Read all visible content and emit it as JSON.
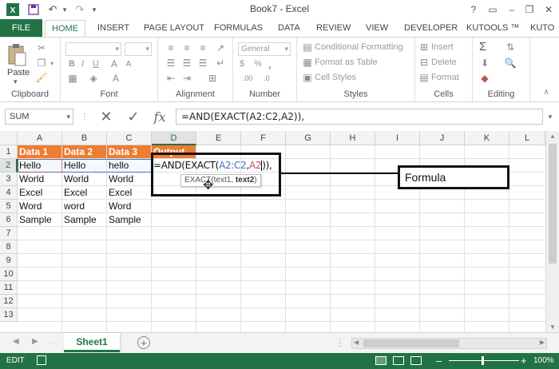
{
  "app": {
    "window_title": "Book7 - Excel",
    "quick_access": [
      "excel-logo-icon",
      "save-icon",
      "undo-icon",
      "redo-icon",
      "customize-icon"
    ],
    "window_controls": [
      "help-icon",
      "ribbon-display-icon",
      "minimize-icon",
      "restore-icon",
      "close-icon"
    ]
  },
  "tabs": {
    "file": "FILE",
    "items": [
      "HOME",
      "INSERT",
      "PAGE LAYOUT",
      "FORMULAS",
      "DATA",
      "REVIEW",
      "VIEW",
      "DEVELOPER",
      "KUTOOLS ™",
      "KUTO"
    ],
    "active": "HOME"
  },
  "ribbon": {
    "clipboard": {
      "label": "Clipboard",
      "paste": "Paste"
    },
    "font": {
      "label": "Font",
      "bold": "B",
      "italic": "I",
      "underline": "U"
    },
    "alignment": {
      "label": "Alignment"
    },
    "number": {
      "label": "Number",
      "format": "General",
      "currency": "$",
      "percent": "%",
      "comma": ","
    },
    "styles": {
      "label": "Styles",
      "conditional": "Conditional Formatting",
      "table": "Format as Table",
      "cell": "Cell Styles"
    },
    "cells": {
      "label": "Cells",
      "insert": "Insert",
      "delete": "Delete",
      "format": "Format"
    },
    "editing": {
      "label": "Editing",
      "sum": "Σ"
    }
  },
  "formula_bar": {
    "name_box": "SUM",
    "fx": "fx",
    "formula": "=AND(EXACT(A2:C2,A2)),"
  },
  "grid": {
    "columns": [
      "A",
      "B",
      "C",
      "D",
      "E",
      "F",
      "G",
      "H",
      "I",
      "J",
      "K",
      "L"
    ],
    "rows": [
      "1",
      "2",
      "3",
      "4",
      "5",
      "6",
      "7",
      "8",
      "9",
      "10",
      "11",
      "12",
      "13"
    ],
    "selected_column": "D",
    "selected_row": "2",
    "headers": [
      "Data 1",
      "Data 2",
      "Data 3",
      "Output"
    ],
    "data": [
      [
        "Hello",
        "Hello",
        "hello"
      ],
      [
        "World",
        "World",
        "World"
      ],
      [
        "Excel",
        "Excel",
        "Excel"
      ],
      [
        "Word",
        "word",
        "Word"
      ],
      [
        "Sample",
        "Sample",
        "Sample"
      ]
    ],
    "editing_cell": {
      "prefix": "=AND(EXACT(",
      "ref1": "A2:C2",
      "comma": ",",
      "ref2": "A2",
      "suffix": ")),"
    },
    "tooltip": {
      "fn": "EXACT(",
      "arg1": "text1",
      "sep": ", ",
      "arg2": "text2",
      "close": ")"
    },
    "callout": "Formula"
  },
  "sheets": {
    "tabs": [
      "Sheet1"
    ],
    "active": "Sheet1",
    "add": "+"
  },
  "status": {
    "mode": "EDIT",
    "zoom": "100%",
    "zoom_minus": "–",
    "zoom_plus": "+"
  },
  "colors": {
    "excel_green": "#217346",
    "header_orange": "#ed7d31",
    "ref_blue": "#4472c4",
    "ref_red": "#c0504d"
  }
}
